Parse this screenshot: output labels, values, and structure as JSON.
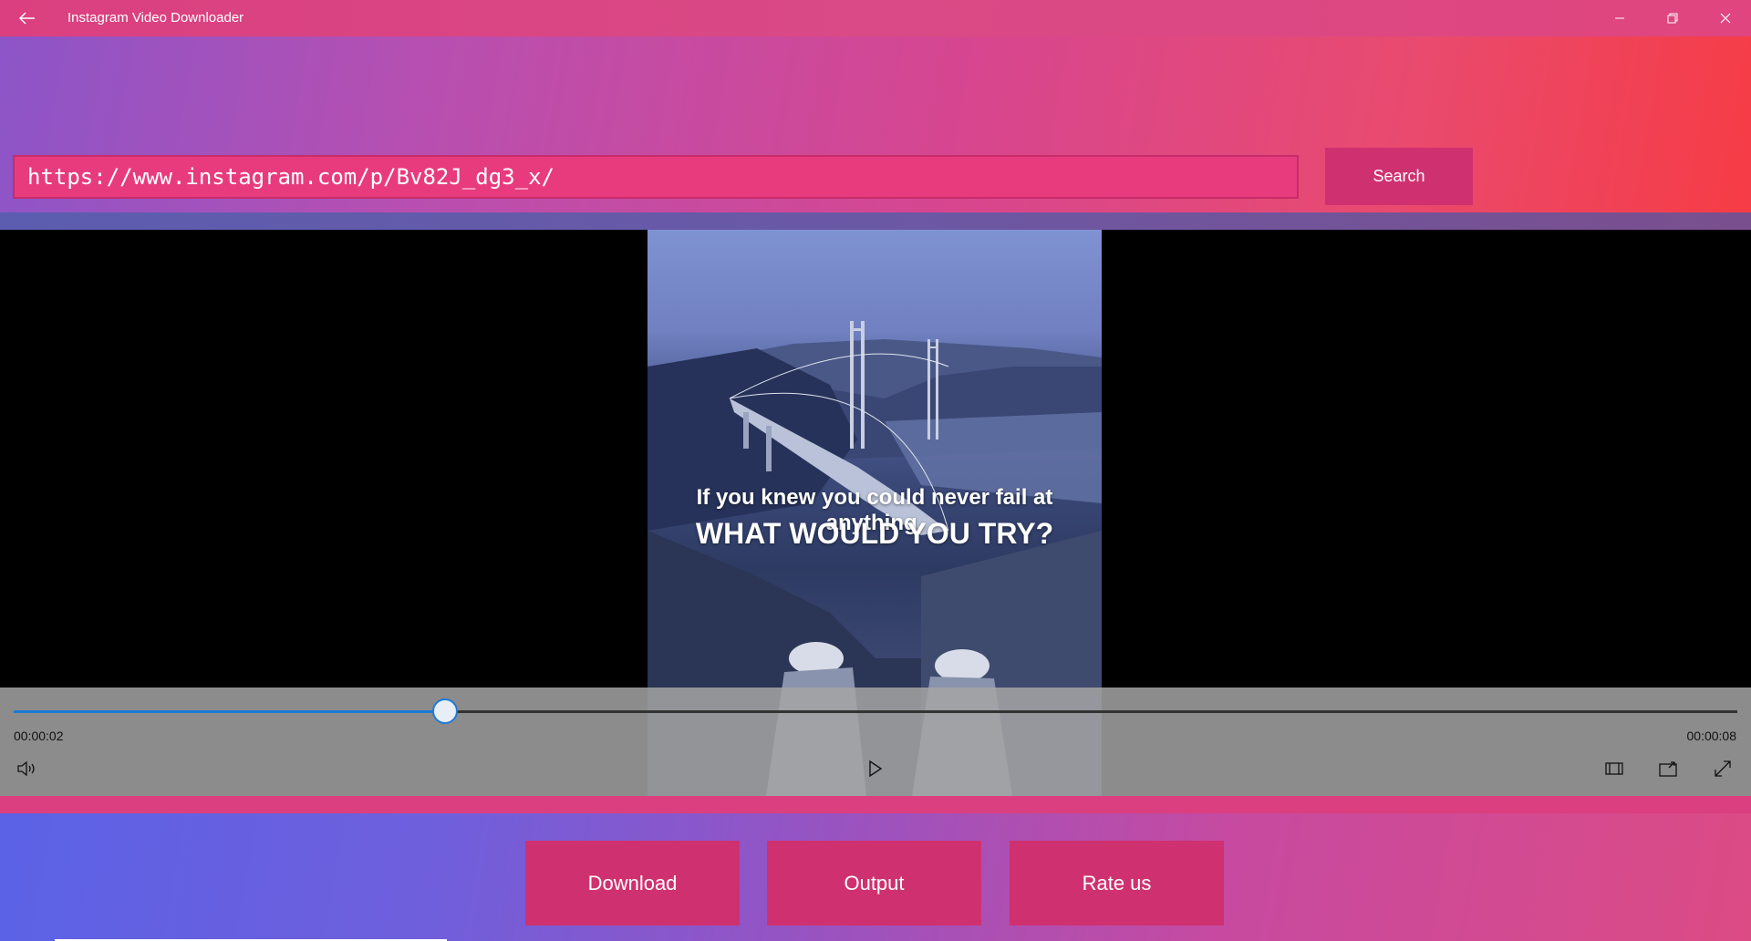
{
  "window": {
    "title": "Instagram Video Downloader",
    "back_icon": "arrow-left-icon",
    "controls": [
      "minimize-icon",
      "restore-icon",
      "close-icon"
    ]
  },
  "search": {
    "url_value": "https://www.instagram.com/p/Bv82J_dg3_x/",
    "button_label": "Search"
  },
  "video": {
    "caption_line1": "If you knew you could never fail at anything.",
    "caption_line2": "WHAT WOULD YOU TRY?"
  },
  "player": {
    "current_time": "00:00:02",
    "total_time": "00:00:08",
    "progress_fraction": 0.25,
    "accent_color": "#1e7ad6",
    "icons": [
      "volume-icon",
      "play-icon",
      "aspect-ratio-icon",
      "cast-icon",
      "fullscreen-icon"
    ]
  },
  "actions": {
    "download_label": "Download",
    "output_label": "Output",
    "rate_label": "Rate us"
  },
  "theme": {
    "primary_pink": "#cf3170",
    "accent_red": "#f63c45",
    "accent_blue": "#5b62e6"
  }
}
